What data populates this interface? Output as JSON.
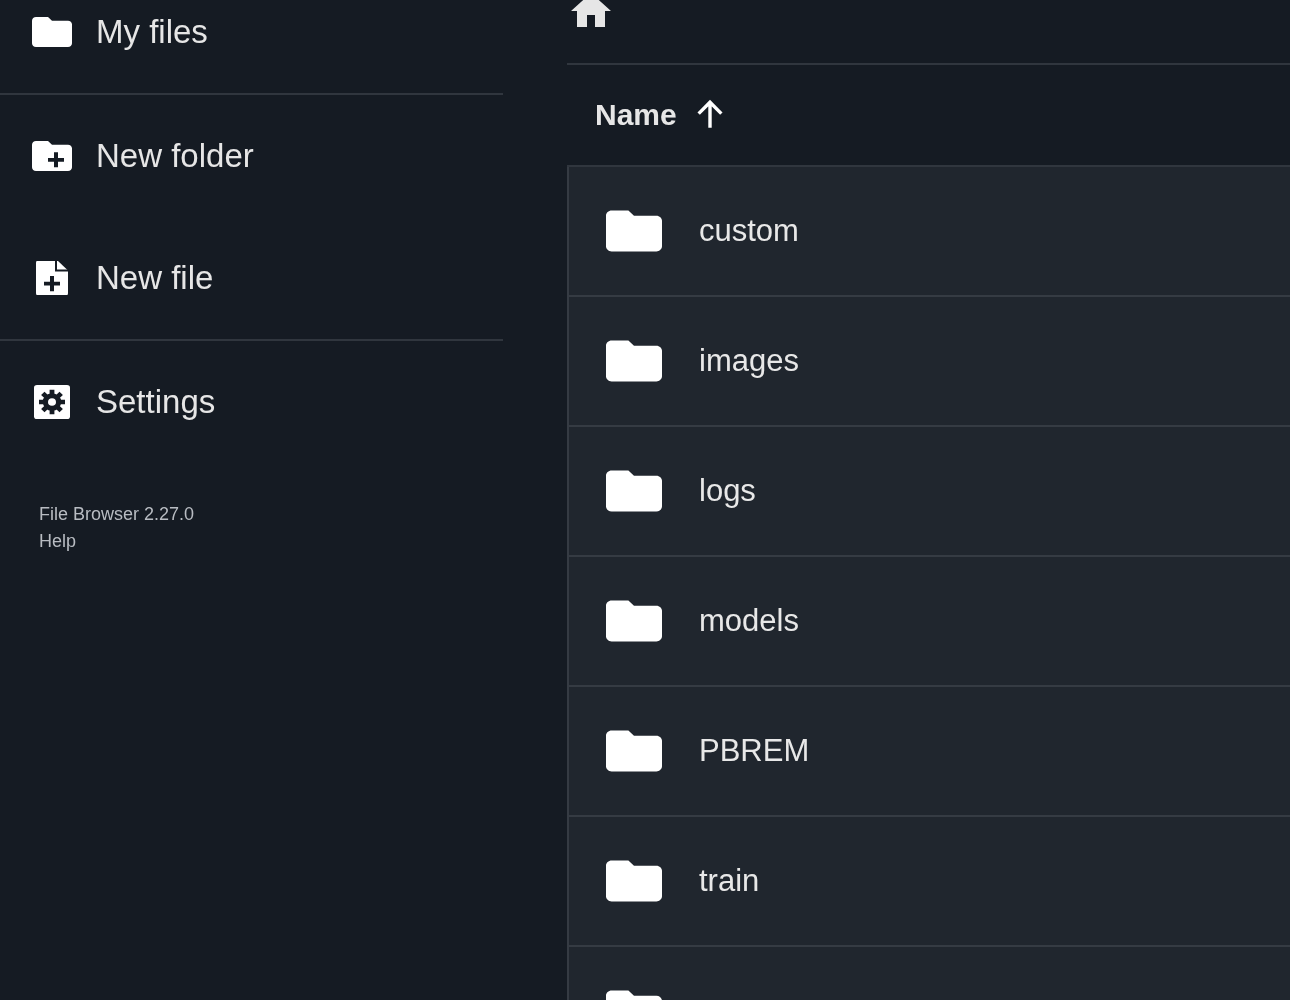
{
  "sidebar": {
    "sections": [
      [
        {
          "kind": "folder",
          "label": "My files"
        }
      ],
      [
        {
          "kind": "new-folder",
          "label": "New folder"
        },
        {
          "kind": "new-file",
          "label": "New file"
        }
      ],
      [
        {
          "kind": "settings",
          "label": "Settings"
        }
      ]
    ],
    "footer": {
      "version": "File Browser 2.27.0",
      "help": "Help"
    }
  },
  "listing": {
    "header": {
      "label": "Name",
      "sort_ascending": true
    },
    "rows": [
      {
        "kind": "folder",
        "name": "custom"
      },
      {
        "kind": "folder",
        "name": "images"
      },
      {
        "kind": "folder",
        "name": "logs"
      },
      {
        "kind": "folder",
        "name": "models"
      },
      {
        "kind": "folder",
        "name": "PBREM"
      },
      {
        "kind": "folder",
        "name": "train"
      },
      {
        "kind": "folder"
      }
    ]
  }
}
